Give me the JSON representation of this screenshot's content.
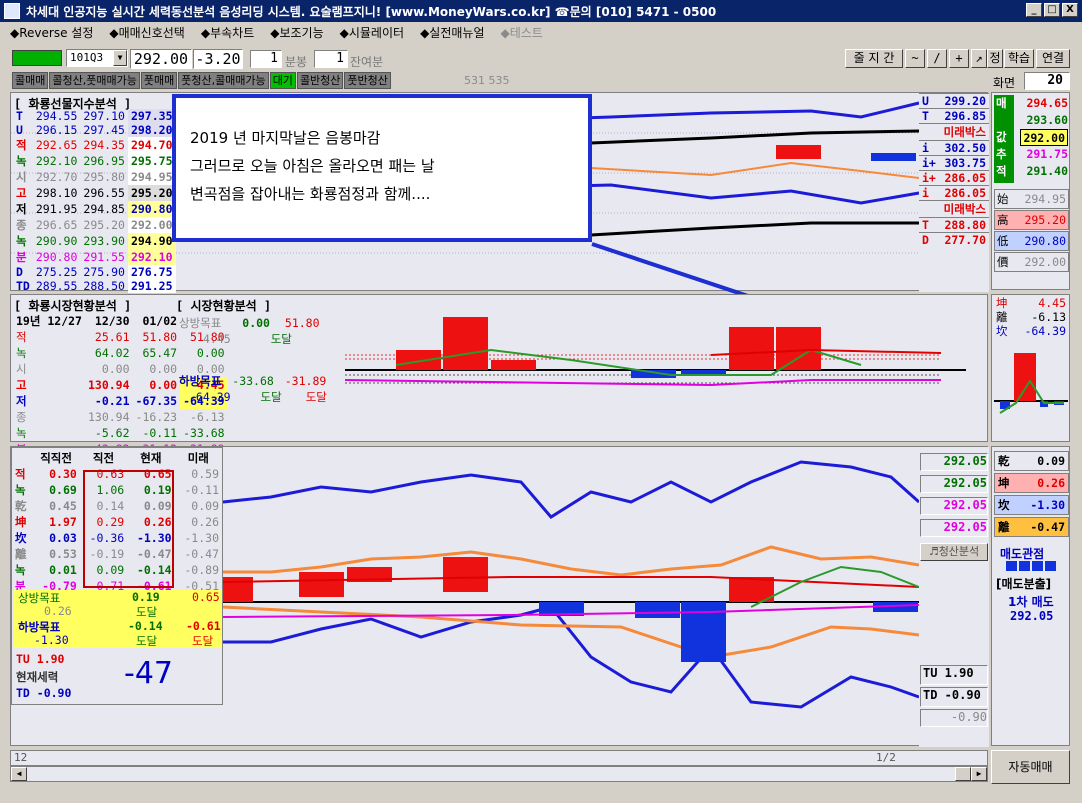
{
  "window": {
    "title": "차세대 인공지능 실시간 세력동선분석 음성리딩 시스템. 요술램프지니! [www.MoneyWars.co.kr] ☎문의 [010] 5471 - 0500",
    "min": "_",
    "max": "□",
    "close": "X"
  },
  "menu": [
    "◆Reverse 설정",
    "◆매매신호선택",
    "◆부속차트",
    "◆보조기능",
    "◆시뮬레이터",
    "◆실전매뉴얼",
    "◆테스트"
  ],
  "toolbar": {
    "code": "101Q3",
    "price": "292.00",
    "change": "-3.20",
    "min_val": "1",
    "min_label": "분봉",
    "rem_val": "1",
    "rem_label": "잔여분",
    "zoom": "줄 지 간",
    "tools": [
      "~",
      "/",
      "+",
      "↗",
      "정",
      "학습",
      "연결"
    ],
    "screen_label": "화면",
    "screen_val": "20",
    "extra": "531 535"
  },
  "tabs": [
    "콜매매",
    "콜청산,풋매매가능",
    "풋매매",
    "풋청산,콜매매가능",
    "대기",
    "콜반청산",
    "풋반청산"
  ],
  "annotation": {
    "line1": "2019 년 마지막날은 음봉마감",
    "line2": "그러므로 오늘 아침은 올라오면 패는 날",
    "line3": "변곡점을 잡아내는 화룡점정과 함께...."
  },
  "panel1": {
    "title": "[ 화룡선물지수분석 ]",
    "rows": [
      [
        "T",
        "294.55",
        "297.10",
        "297.35"
      ],
      [
        "U",
        "296.15",
        "297.45",
        "298.20"
      ],
      [
        "적",
        "292.65",
        "294.35",
        "294.70"
      ],
      [
        "녹",
        "292.10",
        "296.95",
        "295.75"
      ],
      [
        "시",
        "292.70",
        "295.80",
        "294.95"
      ],
      [
        "고",
        "298.10",
        "296.55",
        "295.20"
      ],
      [
        "저",
        "291.95",
        "294.85",
        "290.80"
      ],
      [
        "종",
        "296.65",
        "295.20",
        "292.00"
      ],
      [
        "녹",
        "290.90",
        "293.90",
        "294.90"
      ],
      [
        "분",
        "290.80",
        "291.55",
        "292.10"
      ],
      [
        "D",
        "275.25",
        "275.90",
        "276.75"
      ],
      [
        "TD",
        "289.55",
        "288.50",
        "291.25"
      ]
    ]
  },
  "right1": [
    [
      "U",
      "299.20"
    ],
    [
      "T",
      "296.85"
    ],
    [
      "",
      "미래박스"
    ],
    [
      "i",
      "302.50"
    ],
    [
      "i+",
      "303.75"
    ],
    [
      "i+",
      "286.05"
    ],
    [
      "i",
      "286.05"
    ],
    [
      "",
      "미래박스"
    ],
    [
      "T",
      "288.80"
    ],
    [
      "D",
      "277.70"
    ]
  ],
  "side": {
    "rows": [
      [
        "매",
        "294.65"
      ],
      [
        "",
        "293.60"
      ],
      [
        "값",
        "292.00"
      ],
      [
        "추",
        "291.75"
      ],
      [
        "적",
        "291.40"
      ]
    ],
    "ohlc": [
      [
        "始",
        "294.95"
      ],
      [
        "高",
        "295.20"
      ],
      [
        "低",
        "290.80"
      ],
      [
        "價",
        "292.00"
      ]
    ],
    "mini": [
      [
        "坤",
        "4.45"
      ],
      [
        "離",
        "-6.13"
      ],
      [
        "坎",
        "-64.39"
      ]
    ]
  },
  "panel2": {
    "title1": "[ 화룡시장현황분석 ]",
    "title2": "[ 시장현황분석 ]",
    "head": [
      "19년 12/27",
      "12/30",
      "01/02"
    ],
    "rows": [
      [
        "적",
        "25.61",
        "51.80",
        "51.80"
      ],
      [
        "녹",
        "64.02",
        "65.47",
        "0.00"
      ],
      [
        "시",
        "0.00",
        "0.00",
        "0.00"
      ],
      [
        "고",
        "130.94",
        "0.00",
        "4.45"
      ],
      [
        "저",
        "-0.21",
        "-67.35",
        "-64.39"
      ],
      [
        "종",
        "130.94",
        "-16.23",
        "-6.13"
      ],
      [
        "녹",
        "-5.62",
        "-0.11",
        "-33.68"
      ],
      [
        "분",
        "-43.82",
        "-31.12",
        "-31.89"
      ]
    ],
    "up_label": "상방목표",
    "up_v1": "0.00",
    "up_v2": "51.80",
    "up_sub": "4.45",
    "up_reach": "도달",
    "dn_label": "하방목표",
    "dn_v1": "-33.68",
    "dn_v2": "-31.89",
    "dn_sub": "-64.39",
    "dn_reach": "도달",
    "dn_reach2": "도달"
  },
  "panel3": {
    "head": [
      "직직전",
      "직전",
      "현재",
      "미래"
    ],
    "rows": [
      [
        "적",
        "0.30",
        "0.63",
        "0.65",
        "0.59"
      ],
      [
        "녹",
        "0.69",
        "1.06",
        "0.19",
        "-0.11"
      ],
      [
        "乾",
        "0.45",
        "0.14",
        "0.09",
        "0.09"
      ],
      [
        "坤",
        "1.97",
        "0.29",
        "0.26",
        "0.26"
      ],
      [
        "坎",
        "0.03",
        "-0.36",
        "-1.30",
        "-1.30"
      ],
      [
        "離",
        "0.53",
        "-0.19",
        "-0.47",
        "-0.47"
      ],
      [
        "녹",
        "0.01",
        "0.09",
        "-0.14",
        "-0.89"
      ],
      [
        "분",
        "-0.79",
        "-0.71",
        "-0.61",
        "-0.51"
      ]
    ],
    "up_label": "상방목표",
    "up_v1": "0.19",
    "up_v2": "0.65",
    "up_sub": "0.26",
    "up_reach": "도달",
    "dn_label": "하방목표",
    "dn_v1": "-0.14",
    "dn_v2": "-0.61",
    "dn_sub": "-1.30",
    "dn_reach": "도달",
    "dn_reach2": "도달",
    "tu": "TU  1.90",
    "force_label": "현재세력",
    "td": "TD -0.90",
    "force": "-47"
  },
  "right3": {
    "vals": [
      "292.05",
      "292.05",
      "292.05",
      "292.05"
    ],
    "btn": "♬청산분석",
    "tu": "TU   1.90",
    "td": "TD  -0.90",
    "last": "-0.90"
  },
  "side3": {
    "rows": [
      [
        "乾",
        "0.09"
      ],
      [
        "坤",
        "0.26"
      ],
      [
        "坎",
        "-1.30"
      ],
      [
        "離",
        "-0.47"
      ]
    ],
    "status": "매도관점",
    "signal": "[매도분출]",
    "order": "1차 매도",
    "order_price": "292.05",
    "auto": "자동매매"
  },
  "status": {
    "left": "12",
    "page": "1/2"
  }
}
